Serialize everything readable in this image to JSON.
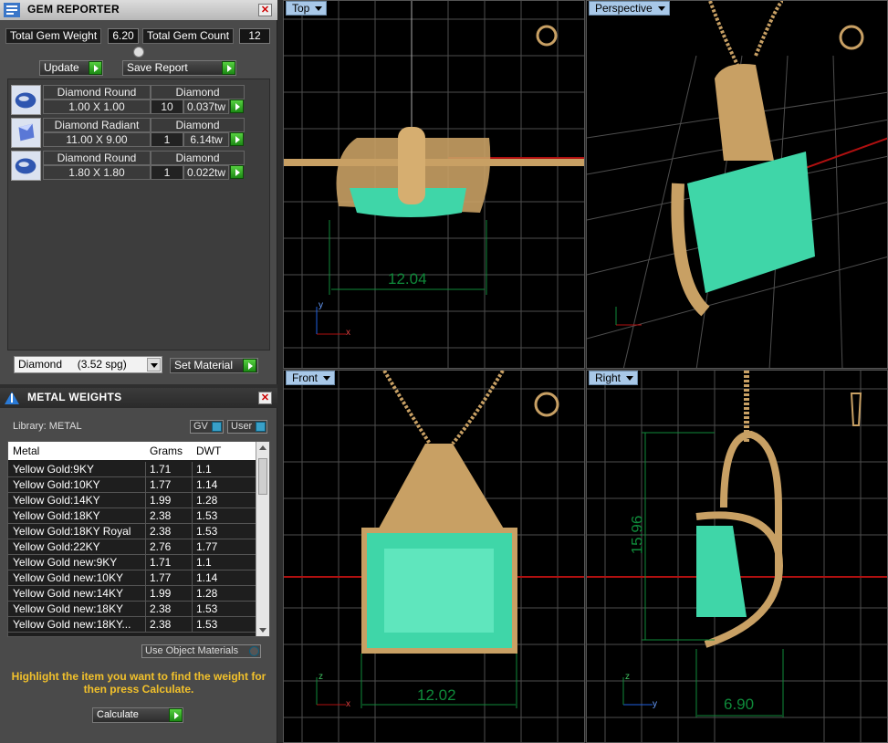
{
  "gem_reporter": {
    "title": "GEM REPORTER",
    "total_weight_label": "Total Gem Weight",
    "total_weight_value": "6.20",
    "total_count_label": "Total Gem Count",
    "total_count_value": "12",
    "update_label": "Update",
    "save_label": "Save Report",
    "gems": [
      {
        "shape": "Diamond Round",
        "material": "Diamond",
        "size": "1.00 X 1.00",
        "count": "10",
        "weight": "0.037tw"
      },
      {
        "shape": "Diamond Radiant",
        "material": "Diamond",
        "size": "11.00 X 9.00",
        "count": "1",
        "weight": "6.14tw"
      },
      {
        "shape": "Diamond Round",
        "material": "Diamond",
        "size": "1.80 X 1.80",
        "count": "1",
        "weight": "0.022tw"
      }
    ],
    "material_select": "Diamond     (3.52 spg)",
    "set_material_label": "Set Material"
  },
  "metal_weights": {
    "title": "METAL WEIGHTS",
    "library_label": "Library: METAL",
    "gv_label": "GV",
    "user_label": "User",
    "columns": [
      "Metal",
      "Grams",
      "DWT"
    ],
    "rows": [
      [
        "Yellow Gold:9KY",
        "1.71",
        "1.1"
      ],
      [
        "Yellow Gold:10KY",
        "1.77",
        "1.14"
      ],
      [
        "Yellow Gold:14KY",
        "1.99",
        "1.28"
      ],
      [
        "Yellow Gold:18KY",
        "2.38",
        "1.53"
      ],
      [
        "Yellow Gold:18KY Royal",
        "2.38",
        "1.53"
      ],
      [
        "Yellow Gold:22KY",
        "2.76",
        "1.77"
      ],
      [
        "Yellow Gold new:9KY",
        "1.71",
        "1.1"
      ],
      [
        "Yellow Gold new:10KY",
        "1.77",
        "1.14"
      ],
      [
        "Yellow Gold new:14KY",
        "1.99",
        "1.28"
      ],
      [
        "Yellow Gold new:18KY",
        "2.38",
        "1.53"
      ],
      [
        "Yellow Gold new:18KY...",
        "2.38",
        "1.53"
      ]
    ],
    "use_object_label": "Use Object Materials",
    "hint": "Highlight the item you want to find the weight for then press Calculate.",
    "calculate_label": "Calculate"
  },
  "viewports": {
    "top": {
      "label": "Top",
      "dim": "12.04"
    },
    "perspective": {
      "label": "Perspective"
    },
    "front": {
      "label": "Front",
      "dim": "12.02"
    },
    "right": {
      "label": "Right",
      "dim_h": "15.96",
      "dim_w": "6.90"
    }
  },
  "colors": {
    "gold": "#c8a064",
    "gem": "#3fd6a8",
    "grid": "#6a6a6a",
    "dim": "#0f8a3a",
    "accent": "#f2c12b"
  }
}
